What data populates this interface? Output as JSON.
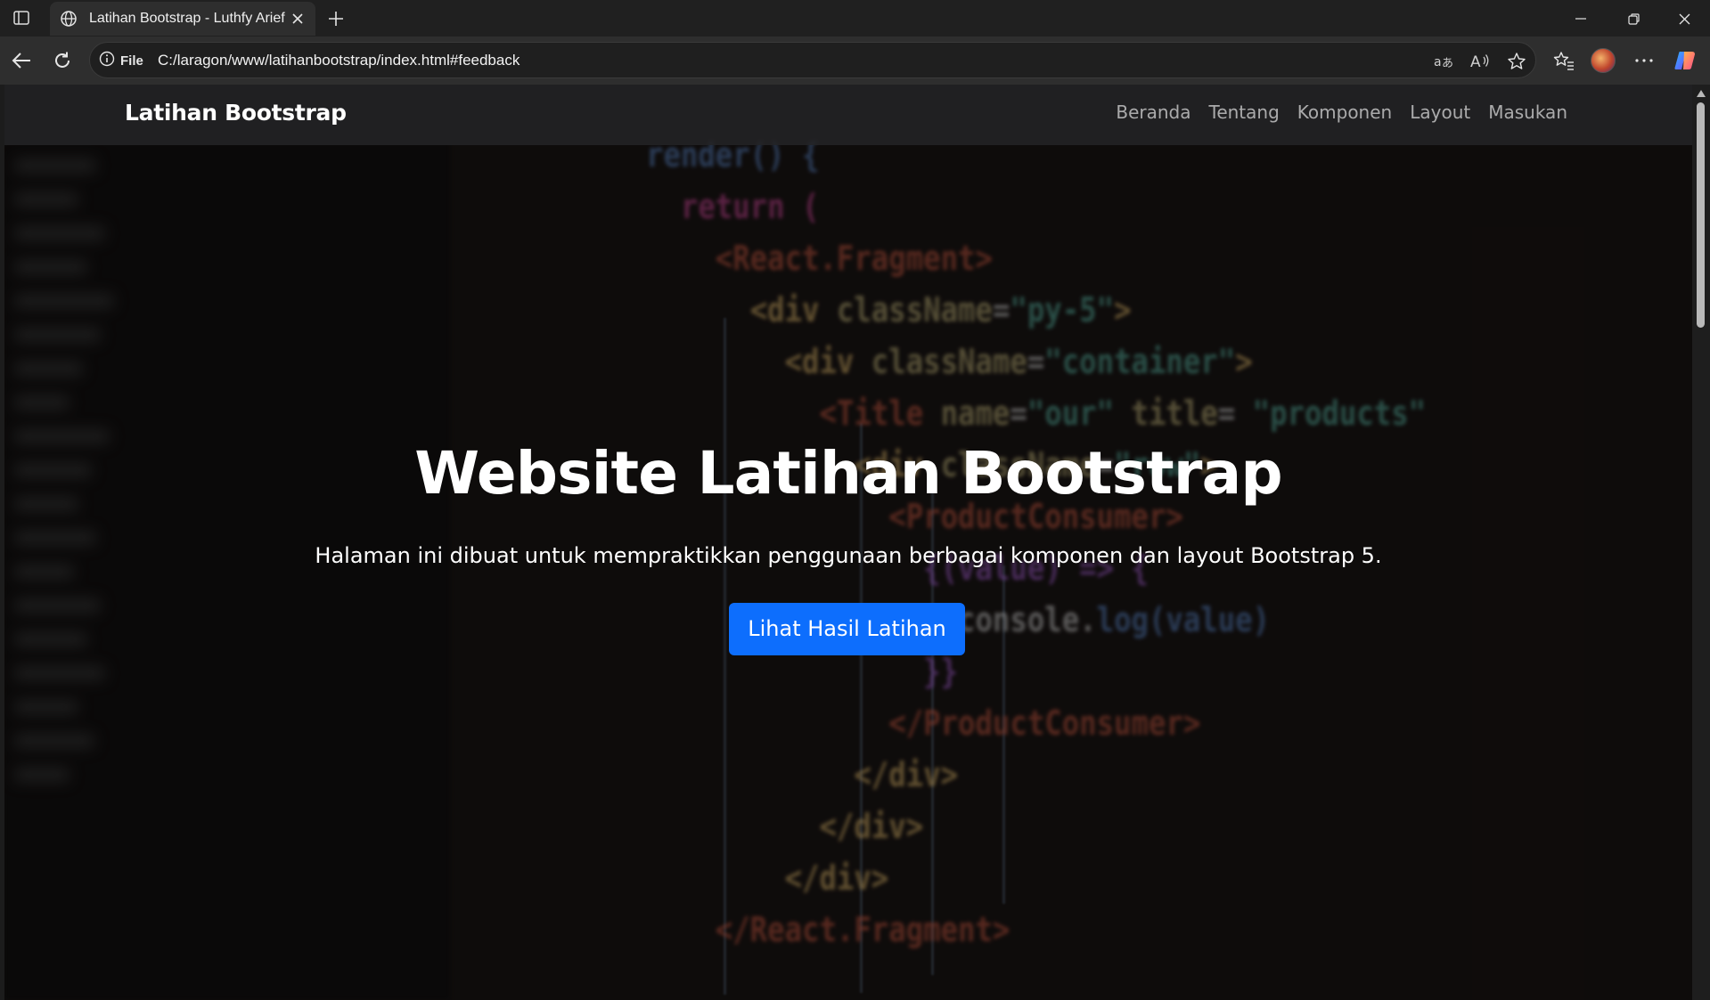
{
  "browser": {
    "tab_title": "Latihan Bootstrap - Luthfy Arief",
    "site_info_label": "File",
    "url": "C:/laragon/www/latihanbootstrap/index.html#feedback"
  },
  "site": {
    "brand": "Latihan Bootstrap",
    "nav": [
      "Beranda",
      "Tentang",
      "Komponen",
      "Layout",
      "Masukan"
    ],
    "hero": {
      "title": "Website Latihan Bootstrap",
      "subtitle": "Halaman ini dibuat untuk mempraktikkan penggunaan berbagai komponen dan layout Bootstrap 5.",
      "button_label": "Lihat Hasil Latihan"
    }
  },
  "colors": {
    "primary_button": "#0d6efd",
    "navbar": "#232326",
    "browser_chrome": "#2e2e2e"
  },
  "icons": [
    "sidebar-toggle-icon",
    "globe-icon",
    "close-icon",
    "plus-icon",
    "minimize-icon",
    "restore-icon",
    "back-arrow-icon",
    "refresh-icon",
    "info-icon",
    "translate-icon",
    "read-aloud-icon",
    "star-icon",
    "favorites-icon",
    "profile-avatar-icon",
    "more-icon",
    "copilot-icon"
  ]
}
